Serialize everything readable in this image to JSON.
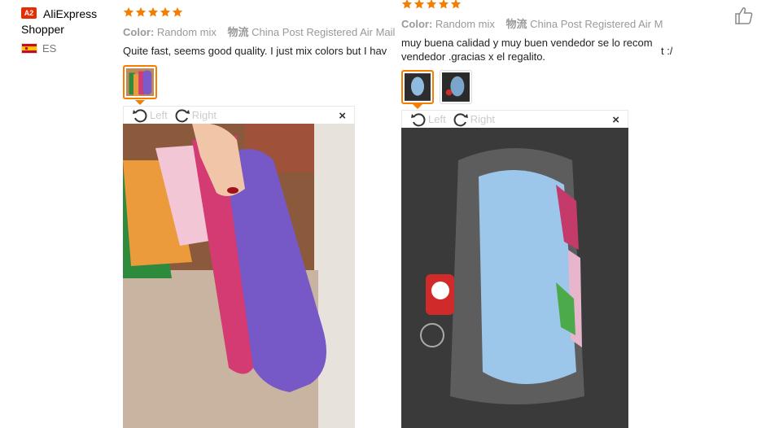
{
  "reviewer": {
    "badge": "A2",
    "name": "AliExpress Shopper",
    "country": "ES"
  },
  "reviews": [
    {
      "rating": 5,
      "color_label": "Color:",
      "color_value": "Random mix",
      "shipping_label": "物流",
      "shipping_value": "China Post Registered Air Mail",
      "text": "Quite fast, seems good quality. I just mix colors but I hav",
      "viewer": {
        "left_label": "Left",
        "right_label": "Right",
        "close": "×"
      }
    },
    {
      "rating": 5,
      "color_label": "Color:",
      "color_value": "Random mix",
      "shipping_label": "物流",
      "shipping_value": "China Post Registered Air M",
      "text_line1": "muy buena calidad y muy buen vendedor se lo recom",
      "text_line1_tail": "t :/",
      "text_line2": "vendedor .gracias x el regalito.",
      "viewer": {
        "left_label": "Left",
        "right_label": "Right",
        "close": "×"
      }
    }
  ],
  "colors": {
    "star": "#f57d00",
    "accent": "#f57d00",
    "badge": "#e62e04"
  }
}
